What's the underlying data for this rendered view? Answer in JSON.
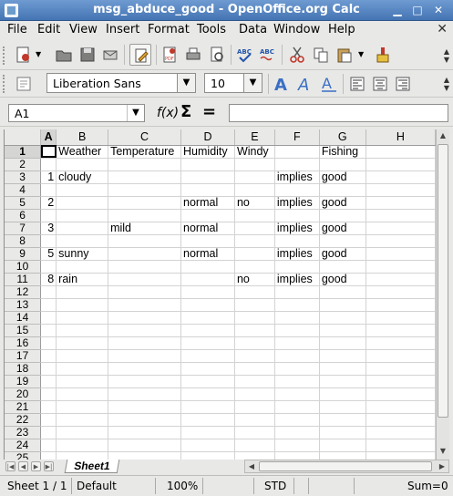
{
  "window": {
    "title": "msg_abduce_good - OpenOffice.org Calc"
  },
  "menubar": {
    "items": [
      "File",
      "Edit",
      "View",
      "Insert",
      "Format",
      "Tools",
      "Data",
      "Window",
      "Help"
    ]
  },
  "format_toolbar": {
    "font_name": "Liberation Sans",
    "font_size": "10"
  },
  "formula_bar": {
    "cell_ref": "A1",
    "function_icon": "f(x)",
    "sum_icon": "Σ",
    "equals_icon": "=",
    "formula_value": ""
  },
  "sheet": {
    "columns": [
      "A",
      "B",
      "C",
      "D",
      "E",
      "F",
      "G",
      "H"
    ],
    "selected_column": "A",
    "selected_row": "1",
    "rows": [
      {
        "n": "1",
        "cells": [
          "",
          "Weather",
          "Temperature",
          "Humidity",
          "Windy",
          "",
          "Fishing",
          ""
        ]
      },
      {
        "n": "2",
        "cells": [
          "",
          "",
          "",
          "",
          "",
          "",
          "",
          ""
        ]
      },
      {
        "n": "3",
        "cells": [
          "1",
          "cloudy",
          "",
          "",
          "",
          "implies",
          "good",
          ""
        ]
      },
      {
        "n": "4",
        "cells": [
          "",
          "",
          "",
          "",
          "",
          "",
          "",
          ""
        ]
      },
      {
        "n": "5",
        "cells": [
          "2",
          "",
          "",
          "normal",
          "no",
          "implies",
          "good",
          ""
        ]
      },
      {
        "n": "6",
        "cells": [
          "",
          "",
          "",
          "",
          "",
          "",
          "",
          ""
        ]
      },
      {
        "n": "7",
        "cells": [
          "3",
          "",
          "mild",
          "normal",
          "",
          "implies",
          "good",
          ""
        ]
      },
      {
        "n": "8",
        "cells": [
          "",
          "",
          "",
          "",
          "",
          "",
          "",
          ""
        ]
      },
      {
        "n": "9",
        "cells": [
          "5",
          "sunny",
          "",
          "normal",
          "",
          "implies",
          "good",
          ""
        ]
      },
      {
        "n": "10",
        "cells": [
          "",
          "",
          "",
          "",
          "",
          "",
          "",
          ""
        ]
      },
      {
        "n": "11",
        "cells": [
          "8",
          "rain",
          "",
          "",
          "no",
          "implies",
          "good",
          ""
        ]
      },
      {
        "n": "12",
        "cells": [
          "",
          "",
          "",
          "",
          "",
          "",
          "",
          ""
        ]
      },
      {
        "n": "13",
        "cells": [
          "",
          "",
          "",
          "",
          "",
          "",
          "",
          ""
        ]
      },
      {
        "n": "14",
        "cells": [
          "",
          "",
          "",
          "",
          "",
          "",
          "",
          ""
        ]
      },
      {
        "n": "15",
        "cells": [
          "",
          "",
          "",
          "",
          "",
          "",
          "",
          ""
        ]
      },
      {
        "n": "16",
        "cells": [
          "",
          "",
          "",
          "",
          "",
          "",
          "",
          ""
        ]
      },
      {
        "n": "17",
        "cells": [
          "",
          "",
          "",
          "",
          "",
          "",
          "",
          ""
        ]
      },
      {
        "n": "18",
        "cells": [
          "",
          "",
          "",
          "",
          "",
          "",
          "",
          ""
        ]
      },
      {
        "n": "19",
        "cells": [
          "",
          "",
          "",
          "",
          "",
          "",
          "",
          ""
        ]
      },
      {
        "n": "20",
        "cells": [
          "",
          "",
          "",
          "",
          "",
          "",
          "",
          ""
        ]
      },
      {
        "n": "21",
        "cells": [
          "",
          "",
          "",
          "",
          "",
          "",
          "",
          ""
        ]
      },
      {
        "n": "22",
        "cells": [
          "",
          "",
          "",
          "",
          "",
          "",
          "",
          ""
        ]
      },
      {
        "n": "23",
        "cells": [
          "",
          "",
          "",
          "",
          "",
          "",
          "",
          ""
        ]
      },
      {
        "n": "24",
        "cells": [
          "",
          "",
          "",
          "",
          "",
          "",
          "",
          ""
        ]
      },
      {
        "n": "25",
        "cells": [
          "",
          "",
          "",
          "",
          "",
          "",
          "",
          ""
        ]
      }
    ]
  },
  "sheet_tabs": {
    "active": "Sheet1"
  },
  "statusbar": {
    "sheet_pos": "Sheet 1 / 1",
    "page_style": "Default",
    "zoom": "100%",
    "mode": "STD",
    "sum": "Sum=0"
  },
  "icons": [
    "new-icon",
    "open-icon",
    "save-icon",
    "email-icon",
    "edit-file-icon",
    "pdf-icon",
    "print-icon",
    "print-preview-icon",
    "spellcheck-icon",
    "autospell-icon",
    "cut-icon",
    "copy-icon",
    "paste-icon",
    "clone-format-icon",
    "font-bold-a-icon",
    "font-italic-a-icon",
    "font-underline-a-icon",
    "align-left-icon",
    "align-center-icon",
    "align-right-icon"
  ]
}
